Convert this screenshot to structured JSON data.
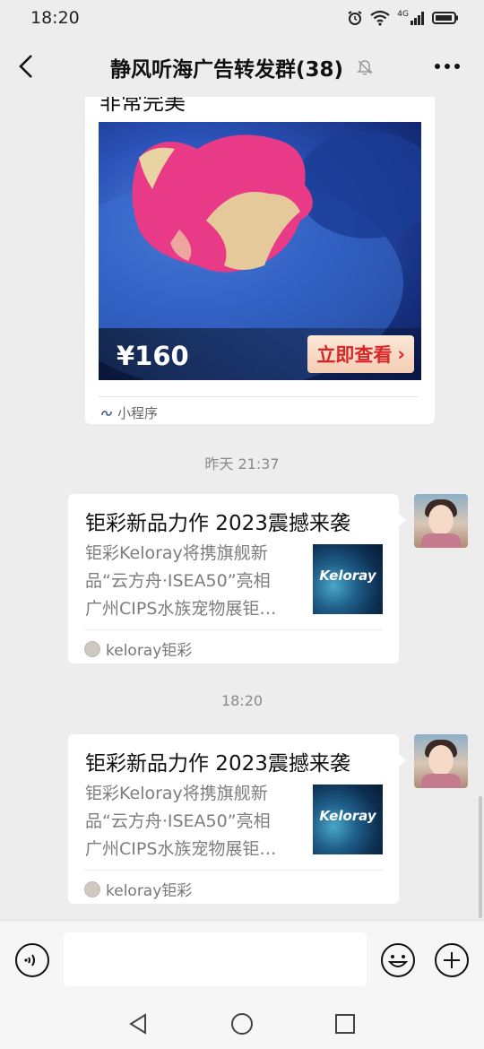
{
  "status_bar": {
    "time": "18:20",
    "network_label": "4G",
    "icons": [
      "alarm-icon",
      "wifi-icon",
      "signal-icon",
      "battery-icon"
    ]
  },
  "nav": {
    "title": "静风听海广告转发群(38)",
    "icons": [
      "back-icon",
      "mute-icon",
      "more-icon"
    ]
  },
  "messages": {
    "mini_program": {
      "title_cut": "非常完美",
      "price": "¥160",
      "cta": "立即查看",
      "tag": "小程序"
    },
    "time1": "昨天 21:37",
    "article1": {
      "title": "钜彩新品力作 2023震撼来袭",
      "desc_lines": [
        "钜彩Keloray将携旗舰新",
        "品“云方舟·ISEA50”亮相",
        "广州CIPS水族宠物展钜…"
      ],
      "thumb_text": "Keloray",
      "source": "keloray钜彩"
    },
    "time2": "18:20",
    "article2": {
      "title": "钜彩新品力作 2023震撼来袭",
      "desc_lines": [
        "钜彩Keloray将携旗舰新",
        "品“云方舟·ISEA50”亮相",
        "广州CIPS水族宠物展钜…"
      ],
      "thumb_text": "Keloray",
      "source": "keloray钜彩"
    }
  },
  "input_bar": {
    "text": "",
    "icons": [
      "voice-icon",
      "emoji-icon",
      "plus-icon"
    ]
  },
  "colors": {
    "background": "#ededed",
    "card": "#ffffff",
    "cta_text": "#d6282b",
    "mini_program_link": "#576b95"
  }
}
